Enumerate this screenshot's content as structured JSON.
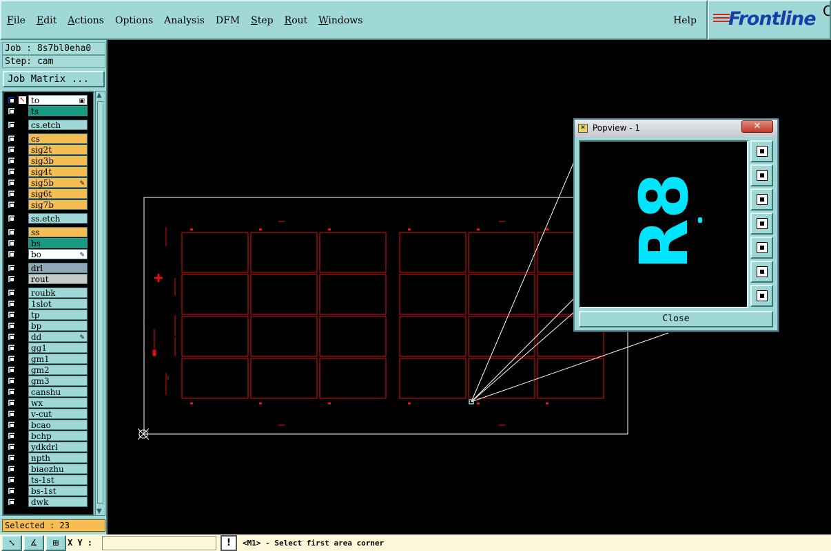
{
  "menu": {
    "items": [
      {
        "label": "File"
      },
      {
        "label": "Edit"
      },
      {
        "label": "Actions"
      },
      {
        "label": "Options"
      },
      {
        "label": "Analysis"
      },
      {
        "label": "DFM"
      },
      {
        "label": "Step"
      },
      {
        "label": "Rout"
      },
      {
        "label": "Windows"
      }
    ],
    "help_label": "Help"
  },
  "logo": {
    "text": "Frontline",
    "trailing": "C"
  },
  "left_panel": {
    "job_line": "Job : 8s7bl0eha0",
    "step_line": "Step: cam",
    "job_matrix_label": "Job Matrix ...",
    "layers": [
      {
        "name": "to",
        "color": "white",
        "mark": "▣"
      },
      {
        "name": "ts",
        "color": "green"
      },
      {
        "name": "cs.etch",
        "color": "teal"
      },
      {
        "name": "cs",
        "color": "orange"
      },
      {
        "name": "sig2t",
        "color": "orange"
      },
      {
        "name": "sig3b",
        "color": "orange"
      },
      {
        "name": "sig4t",
        "color": "orange"
      },
      {
        "name": "sig5b",
        "color": "orange",
        "mark": "✎"
      },
      {
        "name": "sig6t",
        "color": "orange"
      },
      {
        "name": "sig7b",
        "color": "orange"
      },
      {
        "name": "ss.etch",
        "color": "teal"
      },
      {
        "name": "ss",
        "color": "orange"
      },
      {
        "name": "bs",
        "color": "green"
      },
      {
        "name": "bo",
        "color": "white",
        "mark": "✎"
      },
      {
        "name": "drl",
        "color": "slate"
      },
      {
        "name": "rout",
        "color": "gray"
      },
      {
        "name": "roubk",
        "color": "teal"
      },
      {
        "name": "1slot",
        "color": "teal"
      },
      {
        "name": "tp",
        "color": "teal"
      },
      {
        "name": "bp",
        "color": "teal"
      },
      {
        "name": "dd",
        "color": "teal",
        "mark": "✎"
      },
      {
        "name": "gg1",
        "color": "teal"
      },
      {
        "name": "gm1",
        "color": "teal"
      },
      {
        "name": "gm2",
        "color": "teal"
      },
      {
        "name": "gm3",
        "color": "teal"
      },
      {
        "name": "canshu",
        "color": "teal"
      },
      {
        "name": "wx",
        "color": "teal"
      },
      {
        "name": "v-cut",
        "color": "teal"
      },
      {
        "name": "bcao",
        "color": "teal"
      },
      {
        "name": "bchp",
        "color": "teal"
      },
      {
        "name": "ydkdrl",
        "color": "teal"
      },
      {
        "name": "npth",
        "color": "teal"
      },
      {
        "name": "biaozhu",
        "color": "teal"
      },
      {
        "name": "ts-1st",
        "color": "teal"
      },
      {
        "name": "bs-1st",
        "color": "teal"
      },
      {
        "name": "dwk",
        "color": "teal"
      }
    ],
    "selected_line": "Selected : 23"
  },
  "status_bar": {
    "xy_label": "X Y :",
    "xy_value": "",
    "message": "<M1> - Select first area corner"
  },
  "popview": {
    "title": "Popview - 1",
    "preview_text": "R8",
    "close_label": "Close"
  },
  "colors": {
    "panel": "#9fd8d6",
    "board_outline": "#ffffff",
    "pcb_lines": "#e01010",
    "preview_text": "#00e5ff"
  }
}
